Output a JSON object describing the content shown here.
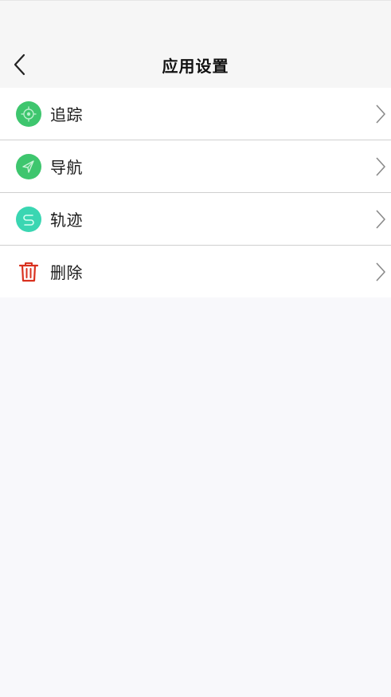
{
  "header": {
    "title": "应用设置",
    "back_icon": "chevron-left-icon"
  },
  "menu": {
    "items": [
      {
        "label": "追踪",
        "icon": "target-icon",
        "icon_color": "#3ec66e"
      },
      {
        "label": "导航",
        "icon": "navigation-arrow-icon",
        "icon_color": "#3ec66e"
      },
      {
        "label": "轨迹",
        "icon": "track-path-icon",
        "icon_color": "#3ad6b2"
      },
      {
        "label": "删除",
        "icon": "trash-icon",
        "icon_color": "#d9311f"
      }
    ],
    "chevron_icon": "chevron-right-icon"
  }
}
